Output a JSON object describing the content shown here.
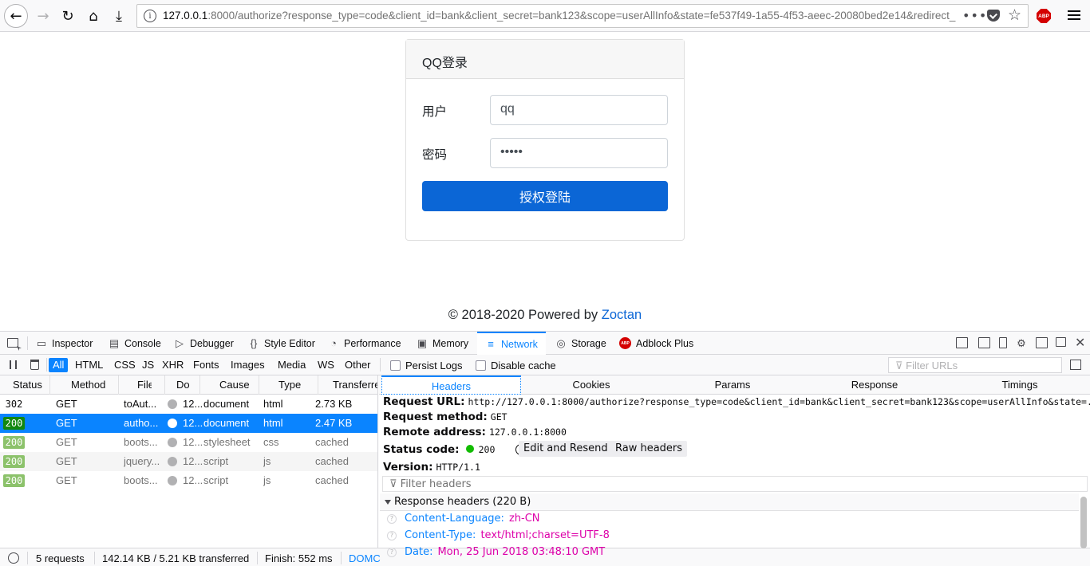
{
  "browser": {
    "url_host": "127.0.0.1",
    "url_rest": ":8000/authorize?response_type=code&client_id=bank&client_secret=bank123&scope=userAllInfo&state=fe537f49-1a55-4f53-aeec-20080bed2e14&redirect_",
    "more_glyph": "•••",
    "abp_label": "ABP"
  },
  "login": {
    "title": "QQ登录",
    "user_label": "用户",
    "user_value": "qq",
    "password_label": "密码",
    "password_value": "•••••",
    "submit_label": "授权登陆"
  },
  "footer": {
    "text": "© 2018-2020 Powered by ",
    "link": "Zoctan"
  },
  "devtools": {
    "tabs": [
      "Inspector",
      "Console",
      "Debugger",
      "Style Editor",
      "Performance",
      "Memory",
      "Network",
      "Storage",
      "Adblock Plus"
    ],
    "filters": [
      "All",
      "HTML",
      "CSS",
      "JS",
      "XHR",
      "Fonts",
      "Images",
      "Media",
      "WS",
      "Other"
    ],
    "persist_logs": "Persist Logs",
    "disable_cache": "Disable cache",
    "filter_urls_placeholder": "Filter URLs",
    "columns": [
      "Status",
      "Method",
      "File",
      "Do",
      "Cause",
      "Type",
      "Transferred"
    ],
    "requests": [
      {
        "status": "302",
        "method": "GET",
        "file": "toAut...",
        "domain": "12...",
        "cause": "document",
        "type": "html",
        "transferred": "2.73 KB"
      },
      {
        "status": "200",
        "method": "GET",
        "file": "autho...",
        "domain": "12...",
        "cause": "document",
        "type": "html",
        "transferred": "2.47 KB"
      },
      {
        "status": "200",
        "method": "GET",
        "file": "boots...",
        "domain": "12...",
        "cause": "stylesheet",
        "type": "css",
        "transferred": "cached"
      },
      {
        "status": "200",
        "method": "GET",
        "file": "jquery...",
        "domain": "12...",
        "cause": "script",
        "type": "js",
        "transferred": "cached"
      },
      {
        "status": "200",
        "method": "GET",
        "file": "boots...",
        "domain": "12...",
        "cause": "script",
        "type": "js",
        "transferred": "cached"
      }
    ],
    "detail_tabs": [
      "Headers",
      "Cookies",
      "Params",
      "Response",
      "Timings"
    ],
    "request_url_label": "Request URL:",
    "request_url": "http://127.0.0.1:8000/authorize?response_type=code&client_id=bank&client_secret=bank123&scope=userAllInfo&state=...",
    "request_method_label": "Request method:",
    "request_method": "GET",
    "remote_address_label": "Remote address:",
    "remote_address": "127.0.0.1:8000",
    "status_code_label": "Status code:",
    "status_code": "200",
    "edit_resend": "Edit and Resend",
    "raw_headers": "Raw headers",
    "version_label": "Version:",
    "version": "HTTP/1.1",
    "filter_headers_placeholder": "Filter headers",
    "response_headers_title": "Response headers (220 B)",
    "response_headers": [
      {
        "key": "Content-Language:",
        "value": "zh-CN"
      },
      {
        "key": "Content-Type:",
        "value": "text/html;charset=UTF-8"
      },
      {
        "key": "Date:",
        "value": "Mon, 25 Jun 2018 03:48:10 GMT"
      }
    ],
    "status_bar": {
      "requests": "5 requests",
      "transferred": "142.14 KB / 5.21 KB transferred",
      "finish": "Finish: 552 ms",
      "domcontent": "DOMC"
    }
  }
}
